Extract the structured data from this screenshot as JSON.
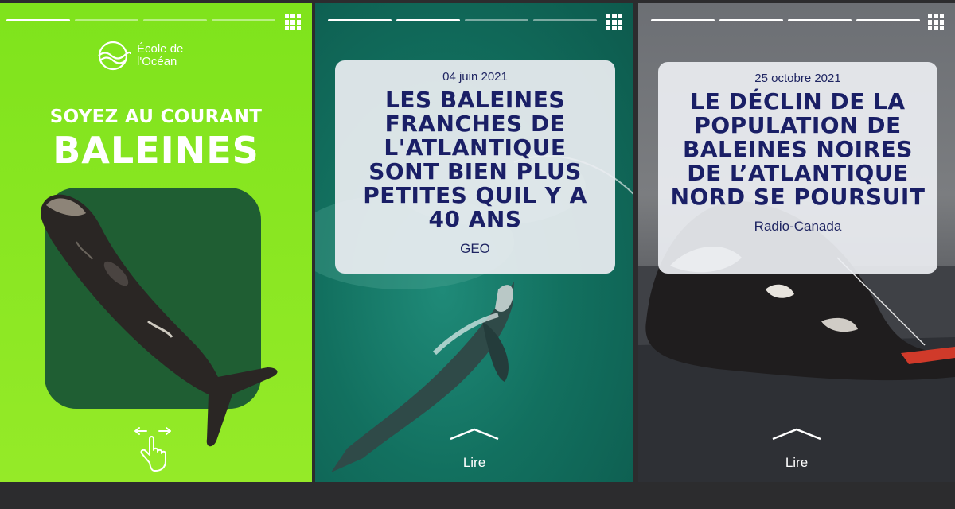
{
  "stories": [
    {
      "logo_line1": "École de",
      "logo_line2": "l'Océan",
      "heading_small": "SOYEZ AU COURANT",
      "heading_big": "BALEINES"
    },
    {
      "date": "04 juin 2021",
      "title": "LES BALEINES FRANCHES DE L'ATLANTIQUE SONT BIEN PLUS PETITES QUIL Y A 40 ANS",
      "source": "GEO",
      "read_label": "Lire"
    },
    {
      "date": "25 octobre 2021",
      "title": "LE DÉCLIN DE LA POPULATION DE BALEINES NOIRES DE L’ATLANTIQUE NORD SE POURSUIT",
      "source": "Radio-Canada",
      "read_label": "Lire"
    }
  ],
  "colors": {
    "brand_green": "#8ae622",
    "card_text": "#1a1f66",
    "card_bg": "#ebeef2"
  },
  "icons": [
    "grid-menu-icon",
    "ecole-ocean-logo",
    "swipe-hand-icon",
    "chevron-up-icon"
  ]
}
